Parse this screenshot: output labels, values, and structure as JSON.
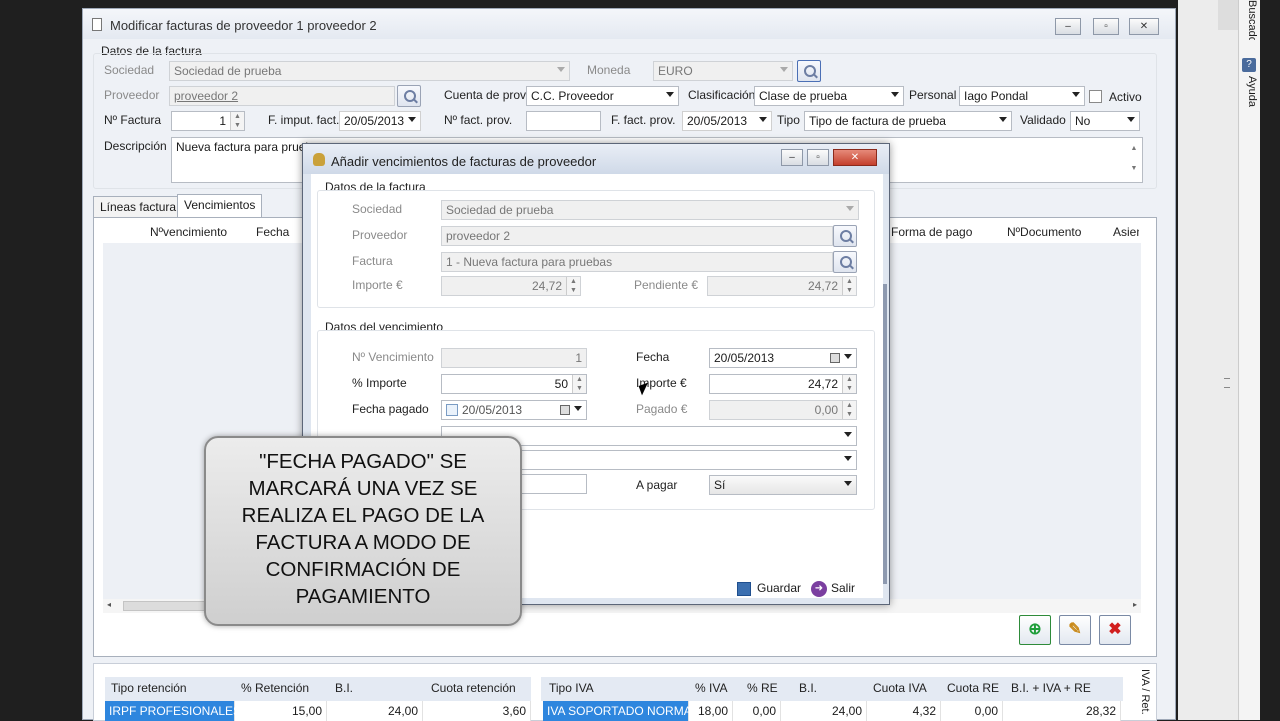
{
  "main_window": {
    "title": "Modificar facturas de proveedor 1 proveedor 2",
    "section_title": "Datos de la factura",
    "sociedad_label": "Sociedad",
    "sociedad_value": "Sociedad de prueba",
    "moneda_label": "Moneda",
    "moneda_value": "EURO",
    "proveedor_label": "Proveedor",
    "proveedor_value": "proveedor 2",
    "cuenta_label": "Cuenta de prov.",
    "cuenta_value": "C.C. Proveedor",
    "clasificacion_label": "Clasificación",
    "clasificacion_value": "Clase de prueba",
    "personal_label": "Personal",
    "personal_value": "Iago Pondal",
    "activo_label": "Activo",
    "nfactura_label": "Nº Factura",
    "nfactura_value": "1",
    "fimput_label": "F. imput. fact.",
    "fimput_value": "20/05/2013",
    "nfactprov_label": "Nº fact. prov.",
    "nfactprov_value": "",
    "ffactprov_label": "F. fact. prov.",
    "ffactprov_value": "20/05/2013",
    "tipo_label": "Tipo",
    "tipo_value": "Tipo de factura de prueba",
    "validado_label": "Validado",
    "validado_value": "No",
    "descripcion_label": "Descripción",
    "descripcion_value": "Nueva factura para pruebas",
    "tabs": [
      "Líneas factura",
      "Vencimientos"
    ],
    "columns": [
      "Nºvencimiento",
      "Fecha",
      "Forma de pago",
      "NºDocumento",
      "Asien"
    ]
  },
  "retencion_table": {
    "headers": [
      "Tipo retención",
      "% Retención",
      "B.I.",
      "Cuota retención"
    ],
    "row": [
      "IRPF PROFESIONALES",
      "15,00",
      "24,00",
      "3,60"
    ]
  },
  "iva_table": {
    "headers": [
      "Tipo IVA",
      "% IVA",
      "% RE",
      "B.I.",
      "Cuota IVA",
      "Cuota RE",
      "B.I. + IVA + RE"
    ],
    "row": [
      "IVA SOPORTADO NORMAL",
      "18,00",
      "0,00",
      "24,00",
      "4,32",
      "0,00",
      "28,32"
    ],
    "side_label": "IVA / Ret."
  },
  "dialog": {
    "title": "Añadir vencimientos de facturas de proveedor",
    "datos_factura_title": "Datos de la factura",
    "sociedad_label": "Sociedad",
    "sociedad_value": "Sociedad de prueba",
    "proveedor_label": "Proveedor",
    "proveedor_value": "proveedor 2",
    "factura_label": "Factura",
    "factura_value": "1 - Nueva factura para pruebas",
    "importe_label": "Importe €",
    "importe_value": "24,72",
    "pendiente_label": "Pendiente €",
    "pendiente_value": "24,72",
    "datos_venc_title": "Datos del vencimiento",
    "nvenc_label": "Nº Vencimiento",
    "nvenc_value": "1",
    "fecha_label": "Fecha",
    "fecha_value": "20/05/2013",
    "pimporte_label": "% Importe",
    "pimporte_value": "50",
    "importe2_label": "Importe €",
    "importe2_value": "24,72",
    "fpagado_label": "Fecha pagado",
    "fpagado_value": "20/05/2013",
    "pagado_label": "Pagado €",
    "pagado_value": "0,00",
    "apagar_label": "A pagar",
    "apagar_value": "Sí",
    "guardar_label": "Guardar",
    "salir_label": "Salir"
  },
  "callout": {
    "text": "\"FECHA PAGADO\" SE MARCARÁ UNA VEZ SE REALIZA EL PAGO DE LA FACTURA A MODO DE CONFIRMACIÓN DE PAGAMIENTO"
  },
  "right_panel": {
    "top_label": "Buscador",
    "help_label": "Ayuda"
  }
}
